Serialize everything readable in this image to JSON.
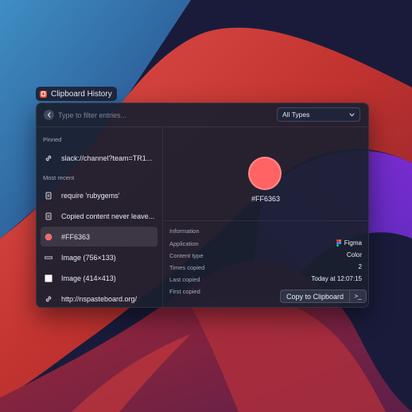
{
  "window": {
    "title": "Clipboard History"
  },
  "search": {
    "placeholder": "Type to filter entries..."
  },
  "type_filter": {
    "selected": "All Types"
  },
  "sidebar": {
    "pinned_label": "Pinned",
    "recent_label": "Most recent",
    "pinned": [
      {
        "label": "slack://channel?team=TR1...",
        "icon": "link-icon"
      }
    ],
    "recent": [
      {
        "label": "require 'rubygems'",
        "icon": "document-icon"
      },
      {
        "label": "Copied content never leave...",
        "icon": "document-icon"
      },
      {
        "label": "#FF6363",
        "icon": "color-swatch-icon",
        "selected": true
      },
      {
        "label": "Image (756×133)",
        "icon": "image-icon"
      },
      {
        "label": "Image (414×413)",
        "icon": "image-icon"
      },
      {
        "label": "http://nspasteboard.org/",
        "icon": "link-icon"
      }
    ]
  },
  "preview": {
    "color": "#FF6363",
    "label": "#FF6363"
  },
  "info": {
    "heading": "Information",
    "rows": [
      {
        "key": "Application",
        "value": "Figma",
        "icon": "figma-icon"
      },
      {
        "key": "Content type",
        "value": "Color"
      },
      {
        "key": "Times copied",
        "value": "2"
      },
      {
        "key": "Last copied",
        "value": "Today at 12:07:15"
      },
      {
        "key": "First copied",
        "value": ""
      }
    ]
  },
  "actions": {
    "copy_label": "Copy to Clipboard",
    "more_label": ">_"
  },
  "colors": {
    "accent": "#FF6363",
    "app_icon": "#F0593F",
    "panel_bg": "#1B1F2F"
  }
}
